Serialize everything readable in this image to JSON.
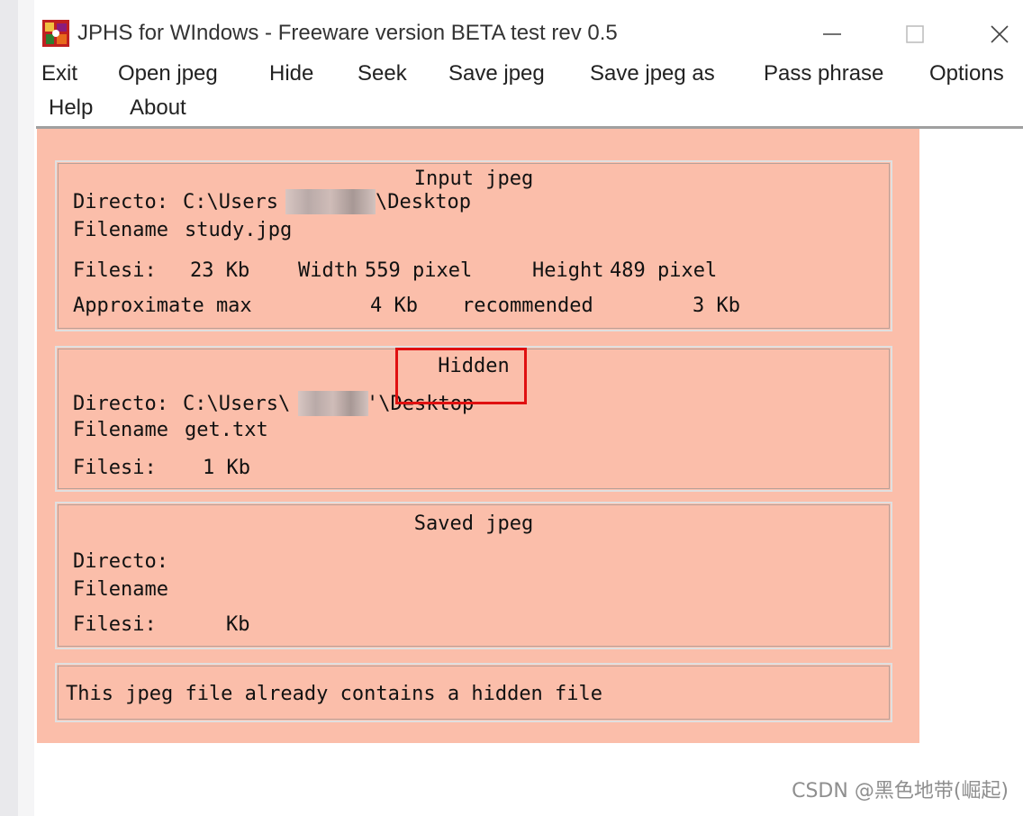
{
  "window": {
    "title": "JPHS for WIndows - Freeware version BETA test rev 0.5",
    "icon": "jphs-app-icon",
    "controls": [
      "minimize-icon",
      "maximize-icon",
      "close-icon"
    ]
  },
  "menu": {
    "items": [
      "Exit",
      "Open jpeg",
      "Hide",
      "Seek",
      "Save jpeg",
      "Save jpeg as",
      "Pass phrase",
      "Options",
      "Help",
      "About"
    ]
  },
  "input_jpeg": {
    "title": "Input jpeg",
    "directory_label": "Directo:",
    "directory_prefix": "C:\\Users",
    "directory_suffix": "\\Desktop",
    "filename_label": "Filename",
    "filename": "study.jpg",
    "filesize_label": "Filesi:",
    "filesize": "23 Kb",
    "width_label": "Width",
    "width": "559 pixel",
    "height_label": "Height",
    "height": "489 pixel",
    "approx_label": "Approximate max",
    "approx_value": "4 Kb",
    "recommended_label": "recommended",
    "recommended_value": "3 Kb"
  },
  "hidden": {
    "title": "Hidden",
    "directory_label": "Directo:",
    "directory_prefix": "C:\\Users\\",
    "directory_suffix": "'\\Desktop",
    "filename_label": "Filename",
    "filename": "get.txt",
    "filesize_label": "Filesi:",
    "filesize": "1 Kb"
  },
  "saved_jpeg": {
    "title": "Saved jpeg",
    "directory_label": "Directo:",
    "filename_label": "Filename",
    "filesize_label": "Filesi:",
    "filesize_unit": "Kb"
  },
  "status": {
    "message": "This jpeg file already contains a hidden file"
  },
  "colors": {
    "client_background": "#fbbeaa",
    "highlight_box": "#e01010"
  },
  "watermark": "CSDN @黑色地带(崛起)"
}
